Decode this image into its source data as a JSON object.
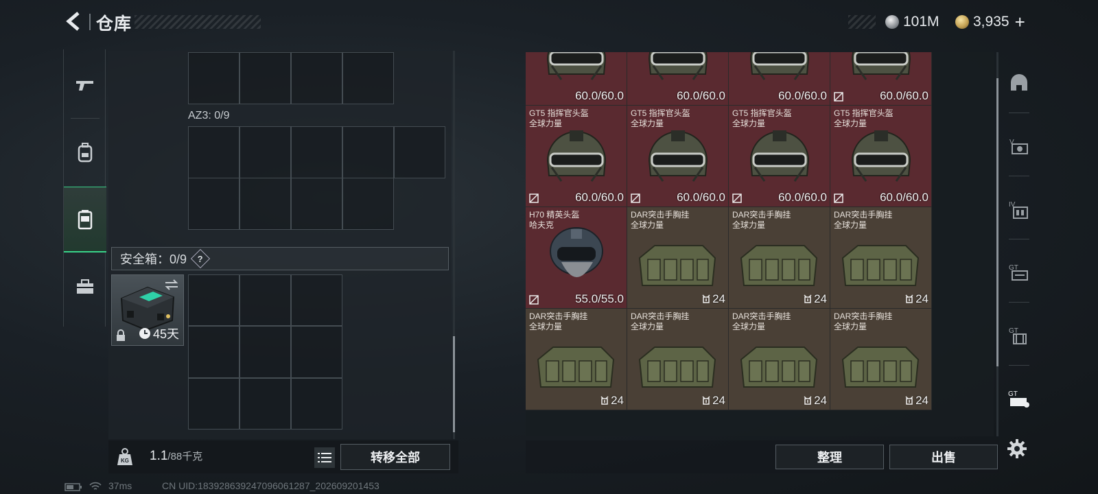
{
  "header": {
    "title": "仓库",
    "currencies": [
      {
        "icon": "silver-coin-icon",
        "amount": "101M"
      },
      {
        "icon": "gold-coin-icon",
        "amount": "3,935"
      }
    ],
    "add_label": "+"
  },
  "left_tabs": [
    {
      "name": "weapons",
      "icon": "pistol-icon"
    },
    {
      "name": "gear",
      "icon": "backpack-icon"
    },
    {
      "name": "containers",
      "icon": "container-icon",
      "active": true
    },
    {
      "name": "supplies",
      "icon": "toolbox-icon"
    }
  ],
  "containers": {
    "az3_label": "AZ3: 0/9",
    "safe_box_label": "安全箱：0/9",
    "help_label": "?",
    "safe_box_days": "45天"
  },
  "bottom_left": {
    "weight_value": "1.1",
    "weight_max": "/88千克",
    "transfer_all_label": "转移全部"
  },
  "storage": {
    "items": [
      {
        "type": "helmet",
        "name1": "",
        "name2": "",
        "value": "60.0/60.0",
        "no_drop": false
      },
      {
        "type": "helmet",
        "name1": "",
        "name2": "",
        "value": "60.0/60.0",
        "no_drop": false
      },
      {
        "type": "helmet",
        "name1": "",
        "name2": "",
        "value": "60.0/60.0",
        "no_drop": false
      },
      {
        "type": "helmet",
        "name1": "",
        "name2": "",
        "value": "60.0/60.0",
        "no_drop": true
      },
      {
        "type": "helmet",
        "name1": "GT5 指挥官头盔",
        "name2": "全球力量",
        "value": "60.0/60.0",
        "no_drop": true
      },
      {
        "type": "helmet",
        "name1": "GT5 指挥官头盔",
        "name2": "全球力量",
        "value": "60.0/60.0",
        "no_drop": true
      },
      {
        "type": "helmet",
        "name1": "GT5 指挥官头盔",
        "name2": "全球力量",
        "value": "60.0/60.0",
        "no_drop": true
      },
      {
        "type": "helmet",
        "name1": "GT5 指挥官头盔",
        "name2": "全球力量",
        "value": "60.0/60.0",
        "no_drop": true
      },
      {
        "type": "h70",
        "name1": "H70 精英头盔",
        "name2": "哈夫克",
        "value": "55.0/55.0",
        "no_drop": true
      },
      {
        "type": "vest",
        "name1": "DAR突击手胸挂",
        "name2": "全球力量",
        "value": "24",
        "no_drop": false
      },
      {
        "type": "vest",
        "name1": "DAR突击手胸挂",
        "name2": "全球力量",
        "value": "24",
        "no_drop": false
      },
      {
        "type": "vest",
        "name1": "DAR突击手胸挂",
        "name2": "全球力量",
        "value": "24",
        "no_drop": false
      },
      {
        "type": "vest",
        "name1": "DAR突击手胸挂",
        "name2": "全球力量",
        "value": "24",
        "no_drop": false
      },
      {
        "type": "vest",
        "name1": "DAR突击手胸挂",
        "name2": "全球力量",
        "value": "24",
        "no_drop": false
      },
      {
        "type": "vest",
        "name1": "DAR突击手胸挂",
        "name2": "全球力量",
        "value": "24",
        "no_drop": false
      },
      {
        "type": "vest",
        "name1": "DAR突击手胸挂",
        "name2": "全球力量",
        "value": "24",
        "no_drop": false
      }
    ],
    "sort_label": "整理",
    "sell_label": "出售"
  },
  "filters": [
    {
      "icon": "helmet-filter-icon"
    },
    {
      "icon": "v-tier-filter-icon"
    },
    {
      "icon": "iv-tier-filter-icon"
    },
    {
      "icon": "gt-filter-icon"
    },
    {
      "icon": "gt-vest-filter-icon"
    },
    {
      "icon": "gt-bag-filter-icon"
    }
  ],
  "status": {
    "ping": "37ms",
    "uid": "CN UID:18392863924709606128​7_202609201453"
  },
  "colors": {
    "accent_green": "#39d38a",
    "helmet_tile": "#5a2a30",
    "vest_tile": "#4a4036"
  }
}
